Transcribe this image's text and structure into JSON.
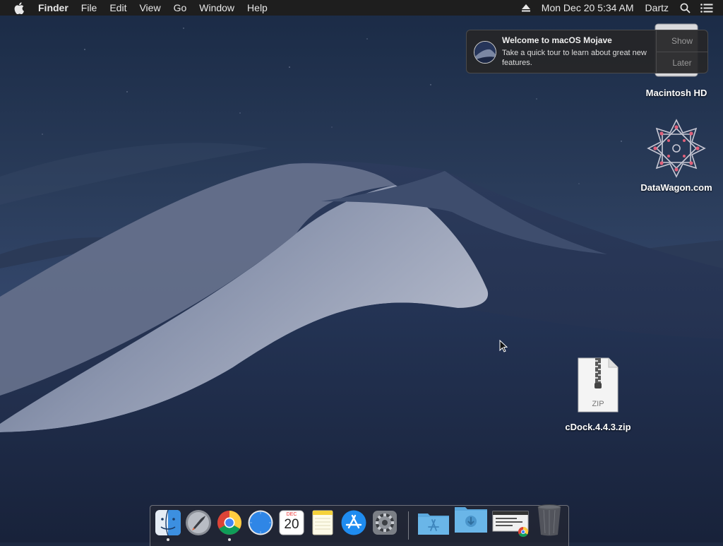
{
  "menubar": {
    "app_name": "Finder",
    "menus": [
      "File",
      "Edit",
      "View",
      "Go",
      "Window",
      "Help"
    ],
    "clock": "Mon Dec 20  5:34 AM",
    "user": "Dartz",
    "icons": [
      "apple-icon",
      "eject-icon",
      "spotlight-search-icon",
      "notification-center-icon"
    ]
  },
  "notification": {
    "title": "Welcome to macOS Mojave",
    "body": "Take a quick tour to learn about great new features.",
    "show_label": "Show",
    "later_label": "Later"
  },
  "desktop": {
    "icons": [
      {
        "label": "Macintosh HD",
        "icon": "hard-drive-icon"
      },
      {
        "label": "DataWagon.com",
        "icon": "datawagon-logo-icon"
      },
      {
        "label": "cDock.4.4.3.zip",
        "icon": "zip-file-icon",
        "badge": "ZIP"
      }
    ]
  },
  "dock": {
    "calendar_month": "DEC",
    "calendar_day": "20",
    "items": [
      {
        "name": "Finder",
        "running": true
      },
      {
        "name": "Launchpad",
        "running": false
      },
      {
        "name": "Google Chrome",
        "running": true
      },
      {
        "name": "Safari",
        "running": false
      },
      {
        "name": "Calendar",
        "running": false
      },
      {
        "name": "Notes",
        "running": false
      },
      {
        "name": "App Store",
        "running": false
      },
      {
        "name": "System Preferences",
        "running": false
      },
      {
        "name": "Applications",
        "running": false
      },
      {
        "name": "Downloads",
        "running": false
      },
      {
        "name": "Screenshot Stack",
        "running": false
      },
      {
        "name": "Trash",
        "running": false
      }
    ]
  }
}
